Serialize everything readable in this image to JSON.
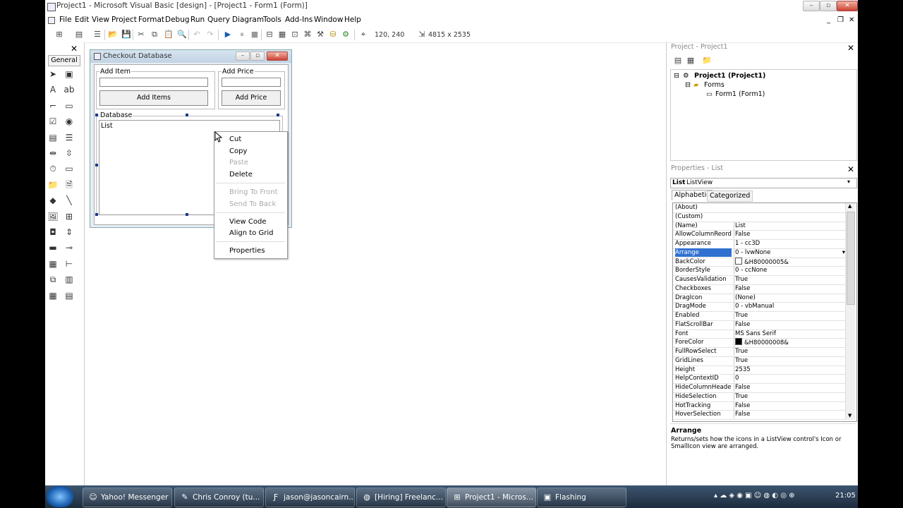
{
  "window": {
    "title": "Project1 - Microsoft Visual Basic [design] - [Project1 - Form1 (Form)]",
    "caption_buttons": [
      "minimize-icon",
      "maximize-icon",
      "close-icon"
    ]
  },
  "menubar": {
    "items": [
      "File",
      "Edit",
      "View",
      "Project",
      "Format",
      "Debug",
      "Run",
      "Query",
      "Diagram",
      "Tools",
      "Add-Ins",
      "Window",
      "Help"
    ]
  },
  "toolbar": {
    "position": "120, 240",
    "size": "4815 x 2535"
  },
  "toolbox": {
    "tab_label": "General",
    "tools": [
      "pointer-icon",
      "picturebox-icon",
      "label-icon",
      "textbox-icon",
      "frame-icon",
      "commandbutton-icon",
      "checkbox-icon",
      "optionbutton-icon",
      "combobox-icon",
      "listbox-icon",
      "hscrollbar-icon",
      "vscrollbar-icon",
      "timer-icon",
      "drivelistbox-icon",
      "dirlistbox-icon",
      "filelistbox-icon",
      "shape-icon",
      "line-icon",
      "image-icon",
      "data-icon",
      "ole-icon",
      "updown-icon",
      "progressbar-icon",
      "slider-icon",
      "toolbar-icon",
      "treeview-icon",
      "imagelist-icon",
      "statusbar-icon",
      "datagrid-icon",
      "listview-icon"
    ]
  },
  "form": {
    "caption": "Checkout Database",
    "add_item_label": "Add Item",
    "add_price_label": "Add Price",
    "add_items_button": "Add Items",
    "add_price_button": "Add Price",
    "database_label": "Database",
    "list_text": "List"
  },
  "context_menu": {
    "cut": "Cut",
    "copy": "Copy",
    "paste": "Paste",
    "delete": "Delete",
    "bring_to_front": "Bring To Front",
    "send_to_back": "Send To Back",
    "view_code": "View Code",
    "align_to_grid": "Align to Grid",
    "properties": "Properties"
  },
  "project_panel": {
    "title": "Project - Project1",
    "root": "Project1 (Project1)",
    "folder": "Forms",
    "form_item": "Form1 (Form1)"
  },
  "properties_panel": {
    "title": "Properties - List",
    "object_name": "List",
    "object_type": "ListView",
    "tab_alphabetic": "Alphabetic",
    "tab_categorized": "Categorized",
    "selected_property": "Arrange",
    "rows": [
      {
        "name": "(About)",
        "value": ""
      },
      {
        "name": "(Custom)",
        "value": ""
      },
      {
        "name": "(Name)",
        "value": "List"
      },
      {
        "name": "AllowColumnReorder",
        "value": "False"
      },
      {
        "name": "Appearance",
        "value": "1 - cc3D"
      },
      {
        "name": "Arrange",
        "value": "0 - lvwNone"
      },
      {
        "name": "BackColor",
        "value": "&H80000005&",
        "swatch": "#ffffff"
      },
      {
        "name": "BorderStyle",
        "value": "0 - ccNone"
      },
      {
        "name": "CausesValidation",
        "value": "True"
      },
      {
        "name": "Checkboxes",
        "value": "False"
      },
      {
        "name": "DragIcon",
        "value": "(None)"
      },
      {
        "name": "DragMode",
        "value": "0 - vbManual"
      },
      {
        "name": "Enabled",
        "value": "True"
      },
      {
        "name": "FlatScrollBar",
        "value": "False"
      },
      {
        "name": "Font",
        "value": "MS Sans Serif"
      },
      {
        "name": "ForeColor",
        "value": "&H80000008&",
        "swatch": "#000000"
      },
      {
        "name": "FullRowSelect",
        "value": "True"
      },
      {
        "name": "GridLines",
        "value": "True"
      },
      {
        "name": "Height",
        "value": "2535"
      },
      {
        "name": "HelpContextID",
        "value": "0"
      },
      {
        "name": "HideColumnHeaders",
        "value": "False"
      },
      {
        "name": "HideSelection",
        "value": "True"
      },
      {
        "name": "HotTracking",
        "value": "False"
      },
      {
        "name": "HoverSelection",
        "value": "False"
      }
    ],
    "description_title": "Arrange",
    "description_text": "Returns/sets how the icons in a ListView control's Icon or SmallIcon view are arranged."
  },
  "taskbar": {
    "items": [
      {
        "label": "Yahoo! Messenger",
        "icon": "smiley-icon"
      },
      {
        "label": "Chris Conroy (tu...",
        "icon": "chat-icon"
      },
      {
        "label": "jason@jasoncairn...",
        "icon": "filezilla-icon"
      },
      {
        "label": "[Hiring] Freelanc...",
        "icon": "firefox-icon"
      },
      {
        "label": "Project1 - Micros...",
        "icon": "vb-icon",
        "active": true
      },
      {
        "label": "Flashing",
        "icon": "window-icon"
      }
    ],
    "clock": "21:05"
  }
}
